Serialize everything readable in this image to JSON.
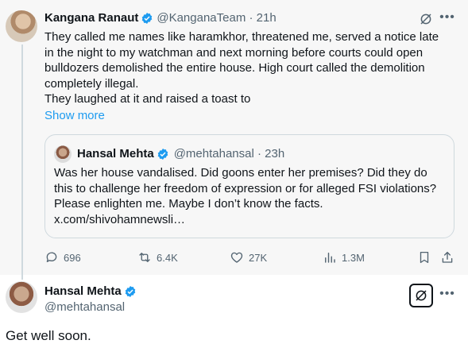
{
  "tweet": {
    "author_name": "Kangana Ranaut",
    "handle_time": "@KanganaTeam · 21h",
    "body_lines": [
      "They called me names like haramkhor,  threatened me, served a notice late",
      "in the night to my watchman and next morning before courts could open",
      "bulldozers demolished the entire house. High court called the demolition",
      "completely illegal.",
      "They laughed at it and raised a toast to"
    ],
    "show_more": "Show more",
    "quote": {
      "author_name": "Hansal Mehta",
      "handle_time": "@mehtahansal · 23h",
      "body_lines": [
        "Was her house vandalised. Did goons enter her premises? Did they do",
        "this to challenge her freedom of expression or for alleged FSI violations?",
        "Please enlighten me. Maybe I don’t know the facts.",
        "x.com/shivohamnewsli…"
      ]
    },
    "actions": {
      "replies": "696",
      "reposts": "6.4K",
      "likes": "27K",
      "views": "1.3M"
    }
  },
  "reply": {
    "author_name": "Hansal Mehta",
    "handle": "@mehtahansal",
    "text": "Get well soon."
  },
  "colors": {
    "verified": "#1d9bf0",
    "link": "#1d9bf0",
    "muted": "#536471"
  },
  "icons": [
    "grok-icon",
    "more-icon",
    "reply-icon",
    "repost-icon",
    "like-icon",
    "views-icon",
    "bookmark-icon",
    "share-icon",
    "verified-badge-icon"
  ]
}
